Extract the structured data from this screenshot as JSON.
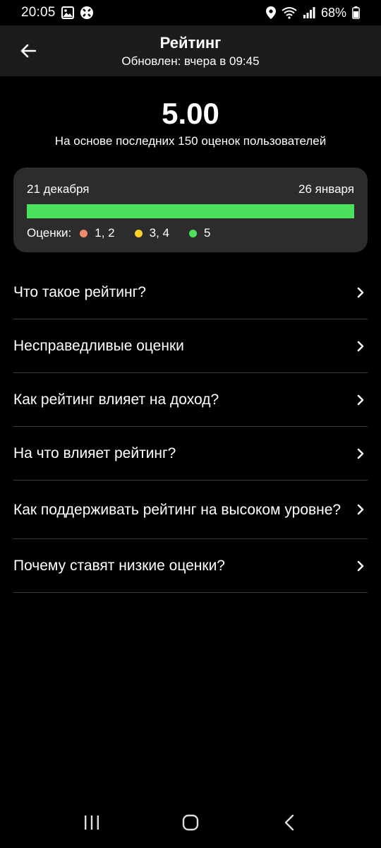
{
  "status_bar": {
    "time": "20:05",
    "battery_text": "68%",
    "icons_left": [
      "gallery-icon",
      "app-notification-icon"
    ],
    "icons_right": [
      "location-icon",
      "wifi-icon",
      "signal-icon",
      "battery-icon"
    ]
  },
  "header": {
    "title": "Рейтинг",
    "subtitle": "Обновлен: вчера в 09:45",
    "back_icon": "arrow-left-icon"
  },
  "score": {
    "value": "5.00",
    "caption": "На основе последних 150 оценок пользователей"
  },
  "rating_card": {
    "date_start": "21 декабря",
    "date_end": "26 января",
    "bar_fraction_green": 1.0,
    "legend_label": "Оценки:",
    "legend": [
      {
        "label": "1, 2",
        "color": "#f28b6a"
      },
      {
        "label": "3, 4",
        "color": "#fcd12a"
      },
      {
        "label": "5",
        "color": "#4be15d"
      }
    ]
  },
  "menu": [
    {
      "label": "Что такое рейтинг?"
    },
    {
      "label": "Несправедливые оценки"
    },
    {
      "label": "Как рейтинг влияет на доход?"
    },
    {
      "label": "На что влияет рейтинг?"
    },
    {
      "label": "Как поддерживать рейтинг на высоком уровне?"
    },
    {
      "label": "Почему ставят низкие оценки?"
    }
  ],
  "colors": {
    "background": "#000000",
    "header_bg": "#1c1c1c",
    "card_bg": "#2c2c2c",
    "accent_green": "#4be15d"
  },
  "nav_bar": {
    "icons": [
      "recent-apps-icon",
      "home-icon",
      "back-icon"
    ]
  }
}
